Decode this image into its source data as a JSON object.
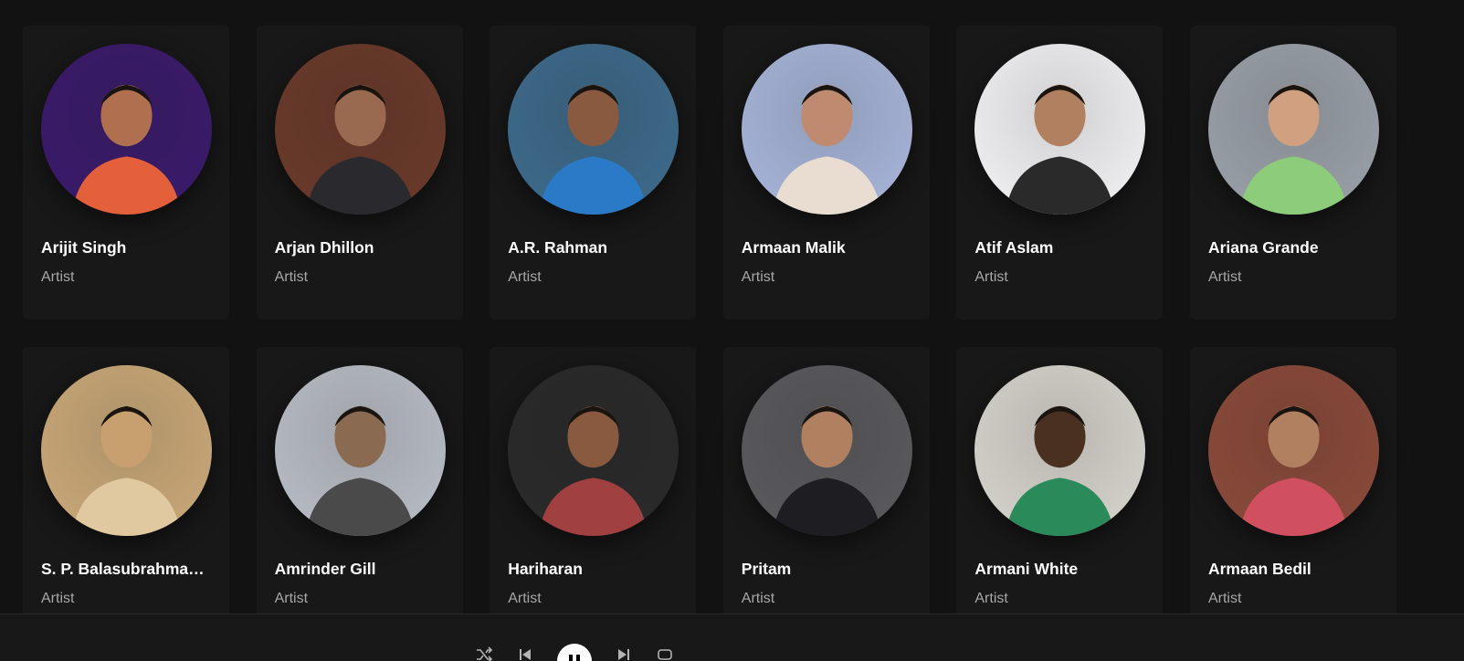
{
  "artists": [
    {
      "name": "Arijit Singh",
      "role": "Artist",
      "bg": "#3a1a6b",
      "fg": "#e4603a",
      "skin": "#b07050"
    },
    {
      "name": "Arjan Dhillon",
      "role": "Artist",
      "bg": "#6a3a2a",
      "fg": "#2a2a2e",
      "skin": "#9a6a50"
    },
    {
      "name": "A.R. Rahman",
      "role": "Artist",
      "bg": "#3d6a8a",
      "fg": "#2a7ac8",
      "skin": "#8a5a40"
    },
    {
      "name": "Armaan Malik",
      "role": "Artist",
      "bg": "#a6b4d8",
      "fg": "#e8ddd0",
      "skin": "#c08a70"
    },
    {
      "name": "Atif Aslam",
      "role": "Artist",
      "bg": "#f1f1f3",
      "fg": "#2a2a2a",
      "skin": "#b08060"
    },
    {
      "name": "Ariana Grande",
      "role": "Artist",
      "bg": "#9aa0a8",
      "fg": "#8ccc7a",
      "skin": "#d0a080"
    },
    {
      "name": "S. P. Balasubrahmanyam",
      "role": "Artist",
      "bg": "#c9a878",
      "fg": "#e0c8a0",
      "skin": "#c8a070"
    },
    {
      "name": "Amrinder Gill",
      "role": "Artist",
      "bg": "#b8bcc4",
      "fg": "#4a4a4a",
      "skin": "#8a6a50"
    },
    {
      "name": "Hariharan",
      "role": "Artist",
      "bg": "#2a2a2a",
      "fg": "#a04040",
      "skin": "#8a5a40"
    },
    {
      "name": "Pritam",
      "role": "Artist",
      "bg": "#5a5a5e",
      "fg": "#1e1e22",
      "skin": "#b08060"
    },
    {
      "name": "Armani White",
      "role": "Artist",
      "bg": "#d6d2cc",
      "fg": "#2a8a5a",
      "skin": "#4a3020"
    },
    {
      "name": "Armaan Bedil",
      "role": "Artist",
      "bg": "#8a4a3a",
      "fg": "#d05060",
      "skin": "#b08060"
    }
  ],
  "player": {
    "shuffle_icon": "shuffle-icon",
    "prev_icon": "previous-icon",
    "play_icon": "pause-icon",
    "next_icon": "next-icon",
    "repeat_icon": "repeat-icon"
  }
}
